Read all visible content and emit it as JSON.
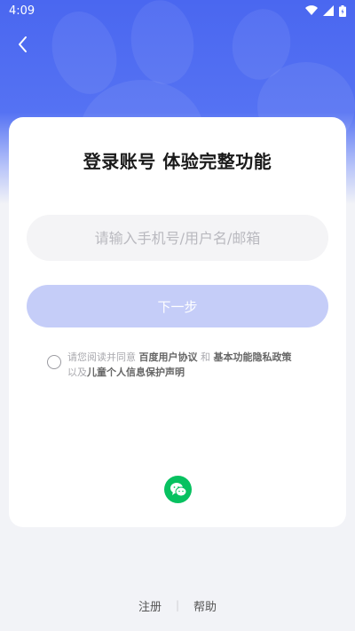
{
  "status": {
    "time": "4:09"
  },
  "login": {
    "title": "登录账号 体验完整功能",
    "input_placeholder": "请输入手机号/用户名/邮箱",
    "input_value": "",
    "next_label": "下一步",
    "agreement": {
      "prefix": "请您阅读并同意 ",
      "link1": "百度用户协议",
      "and": " 和 ",
      "link2": "基本功能隐私政策",
      "line2_prefix": "以及",
      "link3": "儿童个人信息保护声明"
    }
  },
  "footer": {
    "register": "注册",
    "divider": "|",
    "help": "帮助"
  },
  "colors": {
    "brand": "#4a67f0",
    "next_disabled": "#c5cdf8",
    "wechat": "#07c160"
  },
  "icons": [
    "back-icon",
    "wifi-icon",
    "signal-icon",
    "battery-icon",
    "wechat-icon"
  ]
}
